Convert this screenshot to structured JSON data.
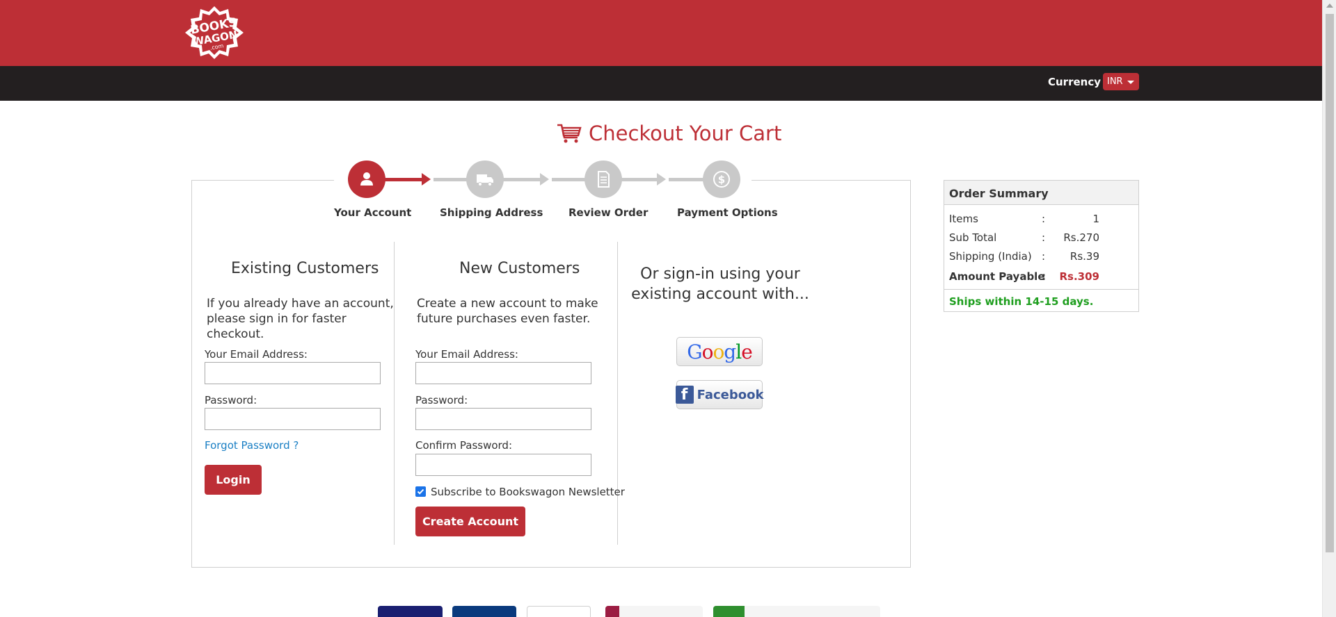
{
  "header": {
    "logo_text_1": "BOOKS",
    "logo_text_2": "WAGON",
    "logo_text_3": ".com",
    "currency_label": "Currency",
    "currency_value": "INR"
  },
  "page": {
    "title": "Checkout Your Cart"
  },
  "steps": [
    {
      "label": "Your Account",
      "icon": "user-icon",
      "active": true
    },
    {
      "label": "Shipping Address",
      "icon": "truck-icon",
      "active": false
    },
    {
      "label": "Review Order",
      "icon": "document-icon",
      "active": false
    },
    {
      "label": "Payment Options",
      "icon": "dollar-icon",
      "active": false
    }
  ],
  "existing": {
    "heading": "Existing Customers",
    "desc": "If you already have an account, please sign in for faster checkout.",
    "email_label": "Your Email Address:",
    "email_value": "",
    "password_label": "Password:",
    "password_value": "",
    "forgot": "Forgot Password ?",
    "login": "Login"
  },
  "new_customers": {
    "heading": "New Customers",
    "desc": "Create a new account to make future purchases even faster.",
    "email_label": "Your Email Address:",
    "email_value": "",
    "password_label": "Password:",
    "password_value": "",
    "confirm_label": "Confirm Password:",
    "confirm_value": "",
    "newsletter": "Subscribe to Bookswagon Newsletter",
    "newsletter_checked": true,
    "create": "Create Account"
  },
  "social": {
    "heading": "Or sign-in using your existing account with...",
    "google": "Google",
    "facebook": "Facebook"
  },
  "summary": {
    "title": "Order Summary",
    "rows": [
      {
        "label": "Items",
        "value": "1"
      },
      {
        "label": "Sub Total",
        "value": "Rs.270"
      },
      {
        "label": "Shipping (India)",
        "value": "Rs.39"
      },
      {
        "label": "Amount Payable",
        "value": "Rs.309"
      }
    ],
    "ships": "Ships within 14-15 days."
  },
  "colors": {
    "brand_red": "#bd2f36",
    "dark_bar": "#231f20",
    "ships_green": "#1e9e1e"
  }
}
